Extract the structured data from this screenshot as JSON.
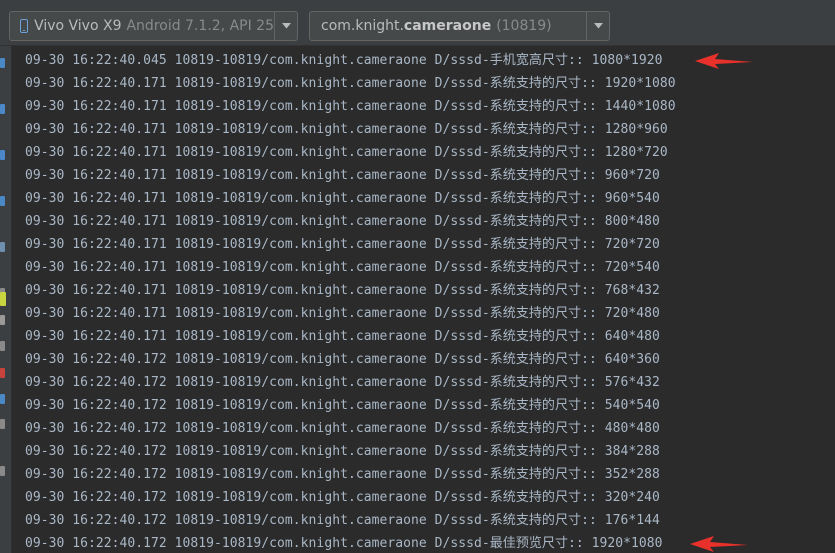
{
  "toolbar": {
    "device": {
      "name": "Vivo Vivo X9",
      "detail": "Android 7.1.2, API 25"
    },
    "process": {
      "prefix": "com.knight.",
      "bold": "cameraone",
      "pid": "(10819)"
    }
  },
  "log_lines": [
    "09-30 16:22:40.045 10819-10819/com.knight.cameraone D/sssd-手机宽高尺寸:: 1080*1920",
    "09-30 16:22:40.171 10819-10819/com.knight.cameraone D/sssd-系统支持的尺寸:: 1920*1080",
    "09-30 16:22:40.171 10819-10819/com.knight.cameraone D/sssd-系统支持的尺寸:: 1440*1080",
    "09-30 16:22:40.171 10819-10819/com.knight.cameraone D/sssd-系统支持的尺寸:: 1280*960",
    "09-30 16:22:40.171 10819-10819/com.knight.cameraone D/sssd-系统支持的尺寸:: 1280*720",
    "09-30 16:22:40.171 10819-10819/com.knight.cameraone D/sssd-系统支持的尺寸:: 960*720",
    "09-30 16:22:40.171 10819-10819/com.knight.cameraone D/sssd-系统支持的尺寸:: 960*540",
    "09-30 16:22:40.171 10819-10819/com.knight.cameraone D/sssd-系统支持的尺寸:: 800*480",
    "09-30 16:22:40.171 10819-10819/com.knight.cameraone D/sssd-系统支持的尺寸:: 720*720",
    "09-30 16:22:40.171 10819-10819/com.knight.cameraone D/sssd-系统支持的尺寸:: 720*540",
    "09-30 16:22:40.171 10819-10819/com.knight.cameraone D/sssd-系统支持的尺寸:: 768*432",
    "09-30 16:22:40.171 10819-10819/com.knight.cameraone D/sssd-系统支持的尺寸:: 720*480",
    "09-30 16:22:40.171 10819-10819/com.knight.cameraone D/sssd-系统支持的尺寸:: 640*480",
    "09-30 16:22:40.172 10819-10819/com.knight.cameraone D/sssd-系统支持的尺寸:: 640*360",
    "09-30 16:22:40.172 10819-10819/com.knight.cameraone D/sssd-系统支持的尺寸:: 576*432",
    "09-30 16:22:40.172 10819-10819/com.knight.cameraone D/sssd-系统支持的尺寸:: 540*540",
    "09-30 16:22:40.172 10819-10819/com.knight.cameraone D/sssd-系统支持的尺寸:: 480*480",
    "09-30 16:22:40.172 10819-10819/com.knight.cameraone D/sssd-系统支持的尺寸:: 384*288",
    "09-30 16:22:40.172 10819-10819/com.knight.cameraone D/sssd-系统支持的尺寸:: 352*288",
    "09-30 16:22:40.172 10819-10819/com.knight.cameraone D/sssd-系统支持的尺寸:: 320*240",
    "09-30 16:22:40.172 10819-10819/com.knight.cameraone D/sssd-系统支持的尺寸:: 176*144",
    "09-30 16:22:40.172 10819-10819/com.knight.cameraone D/sssd-最佳预览尺寸:: 1920*1080"
  ],
  "annotations": [
    {
      "name": "red-arrow-icon",
      "line": 0
    },
    {
      "name": "red-arrow-icon",
      "line": 21
    }
  ],
  "colors": {
    "log_text": "#a9b7c6",
    "background": "#2b2b2b",
    "arrow": "#e8312a"
  },
  "icons": {
    "device": "phone-icon",
    "dropdown": "chevron-down-icon"
  }
}
